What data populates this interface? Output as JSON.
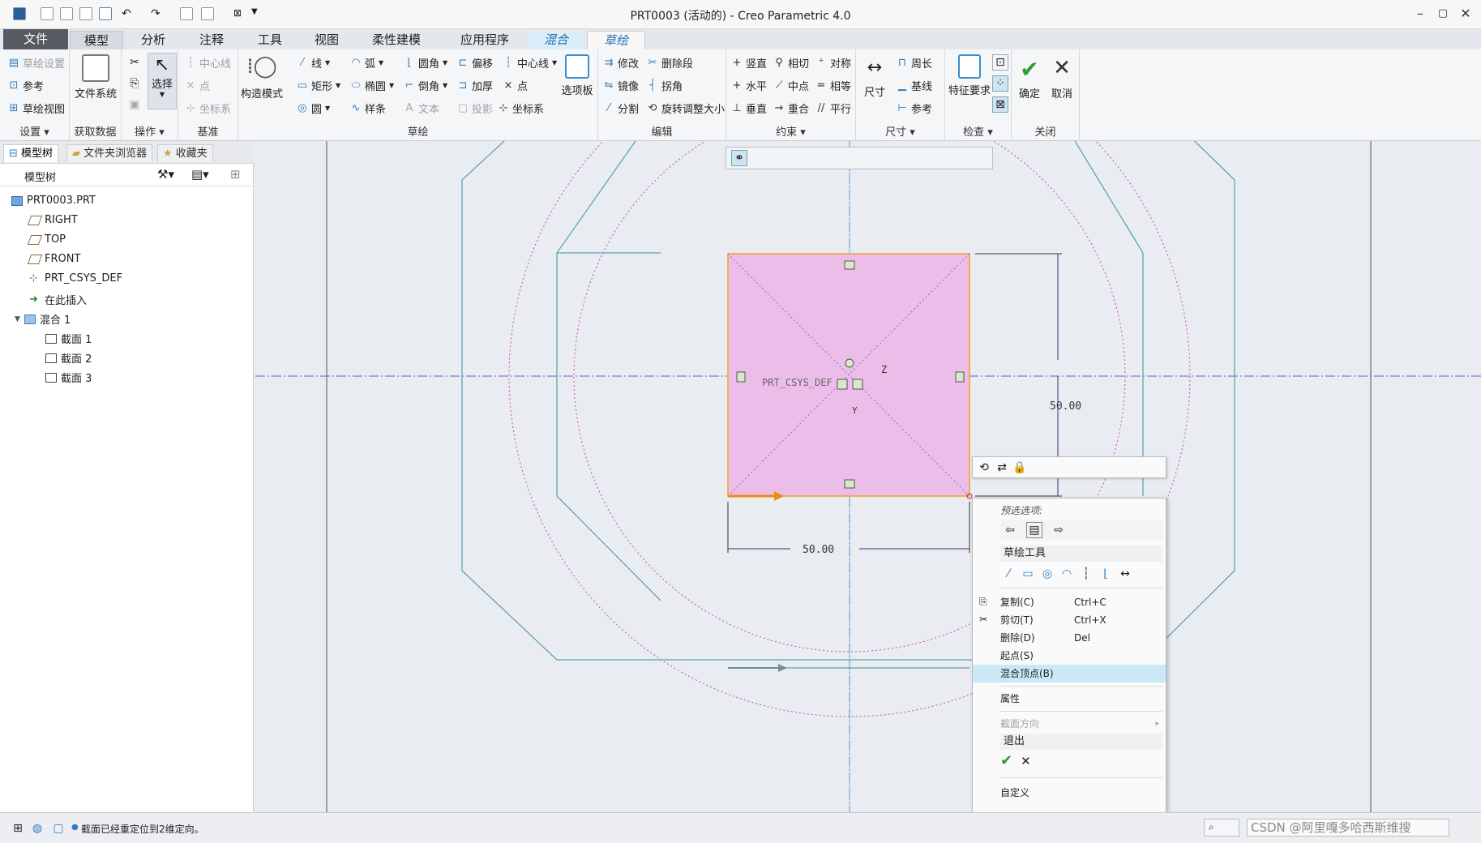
{
  "window": {
    "title": "PRT0003 (活动的) - Creo Parametric 4.0"
  },
  "tabs": [
    "文件",
    "模型",
    "分析",
    "注释",
    "工具",
    "视图",
    "柔性建模",
    "应用程序",
    "混合",
    "草绘"
  ],
  "ribbon": {
    "settings": {
      "label": "设置",
      "items": [
        "草绘设置",
        "参考",
        "草绘视图"
      ]
    },
    "get_data": {
      "label": "获取数据",
      "item": "文件系统"
    },
    "ops": {
      "label": "操作",
      "item": "选择"
    },
    "datum": {
      "label": "基准",
      "items": [
        "中心线",
        "点",
        "坐标系"
      ]
    },
    "construct": "构造模式",
    "sketch": {
      "label": "草绘",
      "items": [
        "线",
        "弧",
        "圆角",
        "偏移",
        "中心线",
        "矩形",
        "椭圆",
        "倒角",
        "加厚",
        "点",
        "圆",
        "样条",
        "文本",
        "投影",
        "坐标系"
      ],
      "palette": "选项板"
    },
    "edit": {
      "label": "编辑",
      "items": [
        "修改",
        "删除段",
        "镜像",
        "拐角",
        "分割",
        "旋转调整大小"
      ]
    },
    "constrain": {
      "label": "约束",
      "items": [
        "竖直",
        "相切",
        "对称",
        "水平",
        "中点",
        "相等",
        "垂直",
        "重合",
        "平行"
      ]
    },
    "dimension": {
      "label": "尺寸",
      "items": [
        "尺寸",
        "周长",
        "基线",
        "参考"
      ]
    },
    "inspect": {
      "label": "检查",
      "item": "特征要求"
    },
    "close": {
      "label": "关闭",
      "ok": "确定",
      "cancel": "取消"
    }
  },
  "panel": {
    "tabs": [
      "模型树",
      "文件夹浏览器",
      "收藏夹"
    ],
    "tree_header": "模型树",
    "nodes": [
      "PRT0003.PRT",
      "RIGHT",
      "TOP",
      "FRONT",
      "PRT_CSYS_DEF",
      "在此插入",
      "混合 1",
      "截面 1",
      "截面 2",
      "截面 3"
    ]
  },
  "canvas": {
    "dim_h": "50.00",
    "dim_v": "50.00",
    "csys_label": "PRT_CSYS_DEF",
    "axis_z": "Z",
    "axis_y": "Y"
  },
  "context_menu": {
    "preselect": "预选选项:",
    "sketch_tools": "草绘工具",
    "items": [
      {
        "label": "复制(C)",
        "shortcut": "Ctrl+C"
      },
      {
        "label": "剪切(T)",
        "shortcut": "Ctrl+X"
      },
      {
        "label": "删除(D)",
        "shortcut": "Del"
      },
      {
        "label": "起点(S)",
        "shortcut": ""
      },
      {
        "label": "混合顶点(B)",
        "shortcut": ""
      }
    ],
    "properties": "属性",
    "section_dir": "截面方向",
    "exit": "退出",
    "customize": "自定义"
  },
  "status": {
    "message": "截面已经重定位到2维定向。",
    "watermark": "CSDN @阿里嘎多哈西斯维搜"
  }
}
